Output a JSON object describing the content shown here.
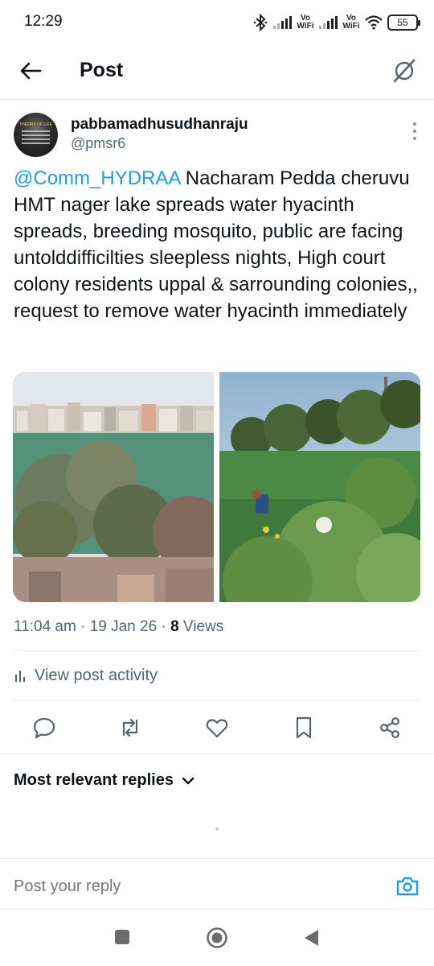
{
  "status_bar": {
    "time": "12:29",
    "network_label_1": "Vo WiFi",
    "network_label_2": "Vo WiFi",
    "battery": "55"
  },
  "header": {
    "title": "Post",
    "back_icon": "arrow-left-icon",
    "grok_icon": "grok-icon"
  },
  "post": {
    "author_name": "pabbamadhusudhanraju",
    "author_handle": "@pmsr6",
    "avatar_text": "THEORY OF LIFE",
    "mention": "@Comm_HYDRAA",
    "text": " Nacharam Pedda cheruvu HMT nager lake spreads water hyacinth spreads, breeding mosquito, public are facing untolddifficilties sleepless nights, High court colony residents uppal & sarrounding colonies,, request to remove water hyacinth immediately",
    "time": "11:04 am",
    "date": "19 Jan 26",
    "views_count": "8",
    "views_label": "Views",
    "separator": "·"
  },
  "activity": {
    "label": "View post activity",
    "icon": "bar-chart-icon"
  },
  "actions": [
    "reply-icon",
    "repost-icon",
    "like-icon",
    "bookmark-icon",
    "share-icon"
  ],
  "replies": {
    "label": "Most relevant replies"
  },
  "composer": {
    "placeholder": "Post your reply",
    "icon": "camera-icon"
  },
  "colors": {
    "accent": "#1d9bf0",
    "text_primary": "#0f1419",
    "text_secondary": "#536471",
    "divider": "#e6e9ec"
  }
}
